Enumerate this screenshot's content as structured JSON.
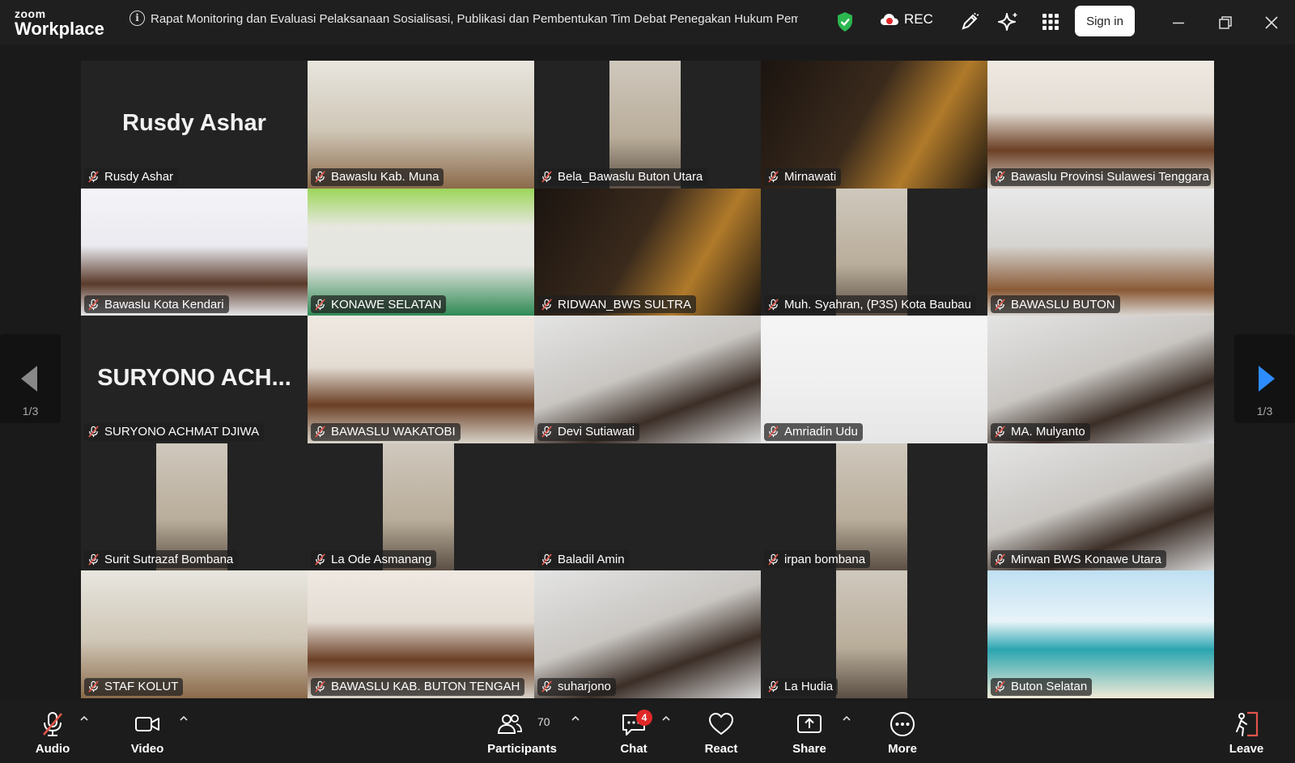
{
  "app": {
    "brand_top": "zoom",
    "brand_bottom": "Workplace"
  },
  "titlebar": {
    "meeting_title": "Rapat Monitoring dan Evaluasi Pelaksanaan Sosialisasi, Publikasi dan Pembentukan Tim Debat Penegakan Hukum Pemilu \\",
    "rec_label": "REC",
    "sign_in_label": "Sign in"
  },
  "colors": {
    "accent_green": "#2cd66f",
    "recording_red": "#e02828",
    "nav_blue": "#2d8cff",
    "muted_red": "#e0554a"
  },
  "nav": {
    "left_page": "1/3",
    "right_page": "1/3"
  },
  "tiles": [
    {
      "name": "Rusdy Ashar",
      "display": "Rusdy Ashar",
      "video": false
    },
    {
      "name": "Bawaslu Kab. Muna",
      "video": true,
      "scene": "office"
    },
    {
      "name": "Bela_Bawaslu Buton Utara",
      "video": true,
      "scene": "portrait"
    },
    {
      "name": "Mirnawati",
      "video": true,
      "scene": "banner"
    },
    {
      "name": "Bawaslu Provinsi Sulawesi Tenggara",
      "video": true,
      "scene": "stage",
      "active": true
    },
    {
      "name": "Bawaslu Kota Kendari",
      "video": true,
      "scene": "stage-white"
    },
    {
      "name": "KONAWE SELATAN",
      "video": true,
      "scene": "green-room"
    },
    {
      "name": "RIDWAN_BWS SULTRA",
      "video": true,
      "scene": "banner"
    },
    {
      "name": "Muh. Syahran, (P3S) Kota Baubau",
      "video": true,
      "scene": "portrait"
    },
    {
      "name": "BAWASLU BUTON",
      "video": true,
      "scene": "meeting"
    },
    {
      "name": "SURYONO ACHMAT DJIWA",
      "display": "SURYONO  ACH...",
      "video": false
    },
    {
      "name": "BAWASLU WAKATOBI",
      "video": true,
      "scene": "stage"
    },
    {
      "name": "Devi Sutiawati",
      "video": true,
      "scene": "close"
    },
    {
      "name": "Amriadin Udu",
      "video": true,
      "scene": "sentra"
    },
    {
      "name": "MA. Mulyanto",
      "video": true,
      "scene": "close"
    },
    {
      "name": "Surit Sutrazaf Bombana",
      "video": true,
      "scene": "portrait"
    },
    {
      "name": "La Ode Asmanang",
      "video": true,
      "scene": "portrait"
    },
    {
      "name": "Baladil Amin",
      "video": false,
      "display": ""
    },
    {
      "name": "irpan bombana",
      "video": true,
      "scene": "portrait"
    },
    {
      "name": "Mirwan BWS Konawe Utara",
      "video": true,
      "scene": "close"
    },
    {
      "name": "STAF KOLUT",
      "video": true,
      "scene": "office"
    },
    {
      "name": "BAWASLU KAB. BUTON TENGAH",
      "video": true,
      "scene": "stage"
    },
    {
      "name": "suharjono",
      "video": true,
      "scene": "close"
    },
    {
      "name": "La Hudia",
      "video": true,
      "scene": "portrait"
    },
    {
      "name": "Buton Selatan",
      "video": true,
      "scene": "beach"
    }
  ],
  "toolbar": {
    "audio": "Audio",
    "video": "Video",
    "participants": "Participants",
    "participants_count": "70",
    "chat": "Chat",
    "chat_badge": "4",
    "react": "React",
    "share": "Share",
    "more": "More",
    "leave": "Leave"
  },
  "icons": [
    "info-icon",
    "shield-icon",
    "cloud-record-icon",
    "pen-icon",
    "sparkle-icon",
    "apps-grid-icon",
    "minimize-icon",
    "restore-icon",
    "close-icon",
    "mic-off-icon",
    "camera-icon",
    "people-icon",
    "chat-bubble-icon",
    "heart-icon",
    "share-screen-icon",
    "more-icon",
    "leave-icon",
    "arrow-left-icon",
    "arrow-right-icon"
  ]
}
